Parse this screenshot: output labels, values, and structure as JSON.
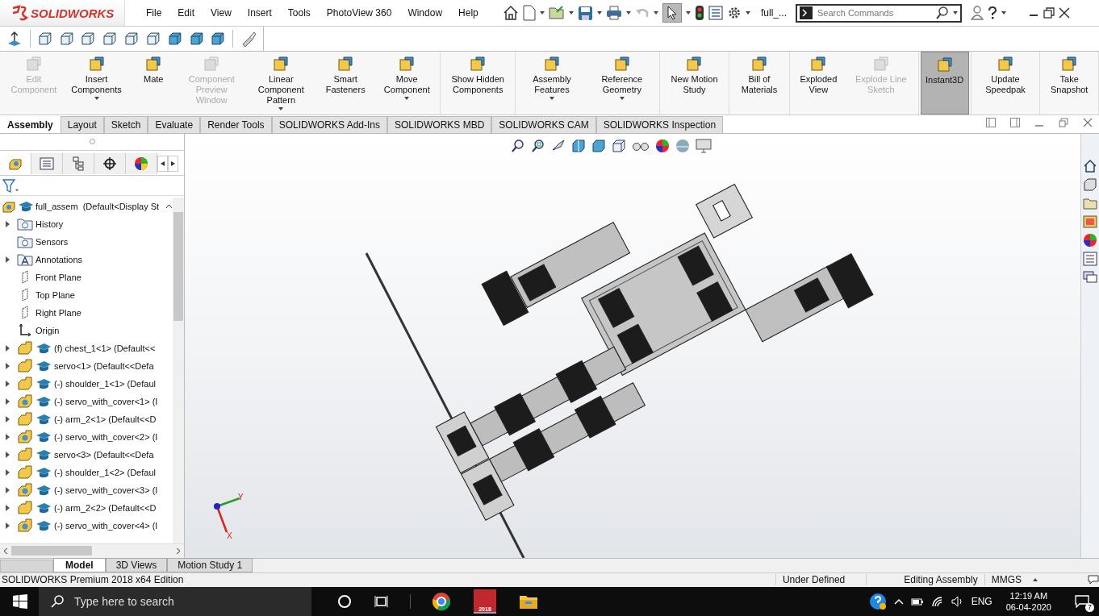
{
  "app": {
    "logo": "SOLIDWORKS"
  },
  "menu": [
    "File",
    "Edit",
    "View",
    "Insert",
    "Tools",
    "PhotoView 360",
    "Window",
    "Help"
  ],
  "document_title": "full_...",
  "search": {
    "placeholder": "Search Commands"
  },
  "ribbon": [
    [
      {
        "label": "Edit Component",
        "disabled": true,
        "dropdown": false,
        "on": false
      },
      {
        "label": "Insert Components",
        "disabled": false,
        "dropdown": true,
        "on": false
      },
      {
        "label": "Mate",
        "disabled": false,
        "dropdown": false,
        "on": false
      },
      {
        "label": "Component Preview Window",
        "disabled": true,
        "dropdown": false,
        "on": false
      },
      {
        "label": "Linear Component Pattern",
        "disabled": false,
        "dropdown": true,
        "on": false
      },
      {
        "label": "Smart Fasteners",
        "disabled": false,
        "dropdown": false,
        "on": false
      },
      {
        "label": "Move Component",
        "disabled": false,
        "dropdown": true,
        "on": false
      }
    ],
    [
      {
        "label": "Show Hidden Components",
        "disabled": false,
        "dropdown": false,
        "on": false
      }
    ],
    [
      {
        "label": "Assembly Features",
        "disabled": false,
        "dropdown": true,
        "on": false
      },
      {
        "label": "Reference Geometry",
        "disabled": false,
        "dropdown": true,
        "on": false
      }
    ],
    [
      {
        "label": "New Motion Study",
        "disabled": false,
        "dropdown": false,
        "on": false
      }
    ],
    [
      {
        "label": "Bill of Materials",
        "disabled": false,
        "dropdown": false,
        "on": false
      }
    ],
    [
      {
        "label": "Exploded View",
        "disabled": false,
        "dropdown": false,
        "on": false
      },
      {
        "label": "Explode Line Sketch",
        "disabled": true,
        "dropdown": false,
        "on": false
      }
    ],
    [
      {
        "label": "Instant3D",
        "disabled": false,
        "dropdown": false,
        "on": true
      }
    ],
    [
      {
        "label": "Update Speedpak",
        "disabled": false,
        "dropdown": false,
        "on": false
      }
    ],
    [
      {
        "label": "Take Snapshot",
        "disabled": false,
        "dropdown": false,
        "on": false
      }
    ]
  ],
  "command_tabs": [
    {
      "label": "Assembly",
      "selected": true
    },
    {
      "label": "Layout",
      "selected": false
    },
    {
      "label": "Sketch",
      "selected": false
    },
    {
      "label": "Evaluate",
      "selected": false
    },
    {
      "label": "Render Tools",
      "selected": false
    },
    {
      "label": "SOLIDWORKS Add-Ins",
      "selected": false
    },
    {
      "label": "SOLIDWORKS MBD",
      "selected": false
    },
    {
      "label": "SOLIDWORKS CAM",
      "selected": false
    },
    {
      "label": "SOLIDWORKS Inspection",
      "selected": false
    }
  ],
  "tree": {
    "root": "full_assem  (Default<Display St",
    "items": [
      {
        "label": "History",
        "kind": "folder",
        "has_children": true
      },
      {
        "label": "Sensors",
        "kind": "folder",
        "has_children": false
      },
      {
        "label": "Annotations",
        "kind": "annotation",
        "has_children": true
      },
      {
        "label": "Front Plane",
        "kind": "plane",
        "has_children": false
      },
      {
        "label": "Top Plane",
        "kind": "plane",
        "has_children": false
      },
      {
        "label": "Right Plane",
        "kind": "plane",
        "has_children": false
      },
      {
        "label": "Origin",
        "kind": "origin",
        "has_children": false
      },
      {
        "label": "(f) chest_1<1> (Default<<",
        "kind": "part",
        "has_children": true
      },
      {
        "label": "servo<1> (Default<<Defa",
        "kind": "part",
        "has_children": true
      },
      {
        "label": "(-) shoulder_1<1> (Defaul",
        "kind": "part",
        "has_children": true
      },
      {
        "label": "(-) servo_with_cover<1> (I",
        "kind": "assembly",
        "has_children": true
      },
      {
        "label": "(-) arm_2<1> (Default<<D",
        "kind": "part",
        "has_children": true
      },
      {
        "label": "(-) servo_with_cover<2> (I",
        "kind": "assembly",
        "has_children": true
      },
      {
        "label": "servo<3> (Default<<Defa",
        "kind": "part",
        "has_children": true
      },
      {
        "label": "(-) shoulder_1<2> (Defaul",
        "kind": "part",
        "has_children": true
      },
      {
        "label": "(-) servo_with_cover<3> (I",
        "kind": "assembly",
        "has_children": true
      },
      {
        "label": "(-) arm_2<2> (Default<<D",
        "kind": "part",
        "has_children": true
      },
      {
        "label": "(-) servo_with_cover<4> (I",
        "kind": "assembly",
        "has_children": true
      }
    ]
  },
  "triad": {
    "labels": [
      "Y",
      "X"
    ]
  },
  "bottom_tabs": [
    {
      "label": "Model",
      "selected": true
    },
    {
      "label": "3D Views",
      "selected": false
    },
    {
      "label": "Motion Study 1",
      "selected": false
    }
  ],
  "status": {
    "edition": "SOLIDWORKS Premium 2018 x64 Edition",
    "items": [
      "Under Defined",
      "Editing Assembly",
      "MMGS"
    ]
  },
  "taskbar": {
    "search_placeholder": "Type here to search",
    "app_badge": "2018",
    "language": "ENG",
    "time": "12:19 AM",
    "date": "06-04-2020",
    "notifications": "7"
  }
}
